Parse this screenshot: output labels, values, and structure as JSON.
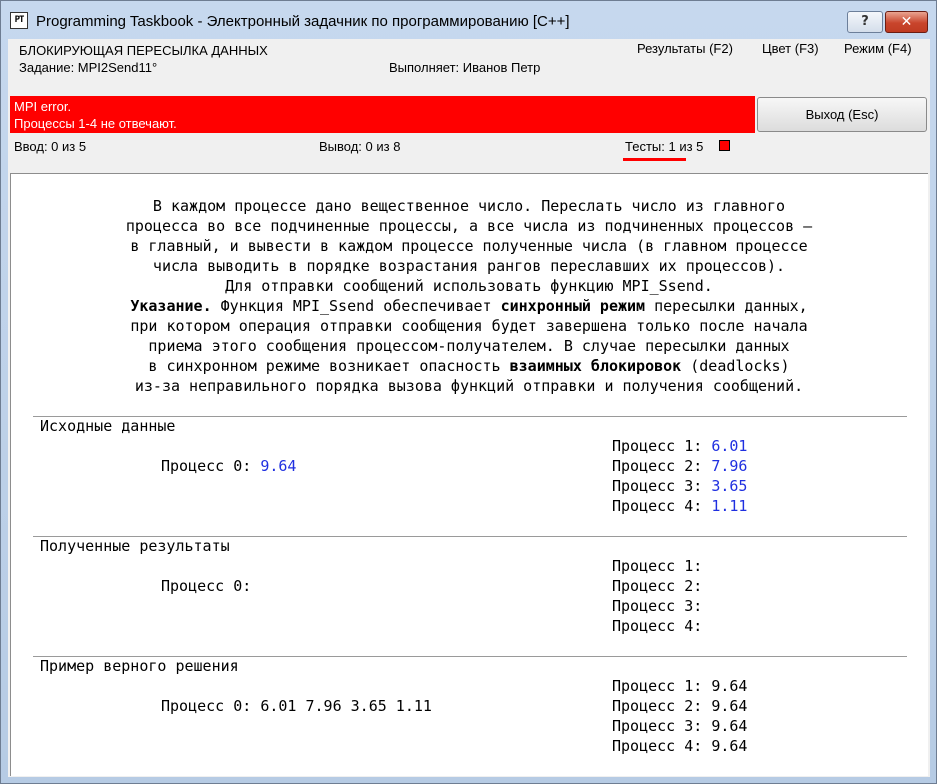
{
  "window": {
    "icon_text": "PT",
    "title": "Programming Taskbook - Электронный задачник по программированию [C++]",
    "help_label": "?",
    "close_label": "✕"
  },
  "header": {
    "task_group": "БЛОКИРУЮЩАЯ ПЕРЕСЫЛКА ДАННЫХ",
    "task_label": "Задание: MPI2Send11°",
    "performer": "Выполняет: Иванов Петр",
    "menu": [
      "Результаты (F2)",
      "Цвет (F3)",
      "Режим (F4)"
    ]
  },
  "error": {
    "line1": "MPI error.",
    "line2": "Процессы 1-4 не отвечают."
  },
  "exit_label": "Выход (Esc)",
  "status": {
    "input": "Ввод: 0 из 5",
    "output": "Вывод: 0 из 8",
    "tests_label": "Тесты:",
    "tests_value": "1 из 5"
  },
  "description": {
    "line1": "В каждом процессе дано вещественное число. Переслать число из главного",
    "line2": "процесса во все подчиненные процессы, а все числа из подчиненных процессов —",
    "line3": "в главный, и вывести в каждом процессе полученные числа (в главном процессе",
    "line4": "числа выводить в порядке возрастания рангов переславших их процессов).",
    "line5": "Для отправки сообщений использовать функцию MPI_Ssend.",
    "line6_bold": "Указание.",
    "line6_a": " Функция MPI_Ssend обеспечивает ",
    "line6_bold2": "синхронный режим",
    "line6_b": " пересылки данных,",
    "line7": "при котором операция отправки сообщения будет завершена только после начала",
    "line8": "приема этого сообщения процессом-получателем. В случае пересылки данных",
    "line9_a": "в синхронном режиме возникает опасность ",
    "line9_bold": "взаимных блокировок",
    "line9_b": " (deadlocks)",
    "line10": "из-за неправильного порядка вызова функций отправки и получения сообщений."
  },
  "input_data": {
    "title": "Исходные данные",
    "p0_label": "Процесс 0: ",
    "p0_value": "9.64",
    "p1_label": "Процесс 1: ",
    "p1_value": "6.01",
    "p2_label": "Процесс 2: ",
    "p2_value": "7.96",
    "p3_label": "Процесс 3: ",
    "p3_value": "3.65",
    "p4_label": "Процесс 4: ",
    "p4_value": "1.11"
  },
  "results": {
    "title": "Полученные результаты",
    "p0": "Процесс 0:",
    "p1": "Процесс 1:",
    "p2": "Процесс 2:",
    "p3": "Процесс 3:",
    "p4": "Процесс 4:"
  },
  "example": {
    "title": "Пример верного решения",
    "p0": "Процесс 0: 6.01 7.96 3.65 1.11",
    "p1": "Процесс 1: 9.64",
    "p2": "Процесс 2: 9.64",
    "p3": "Процесс 3: 9.64",
    "p4": "Процесс 4: 9.64"
  }
}
